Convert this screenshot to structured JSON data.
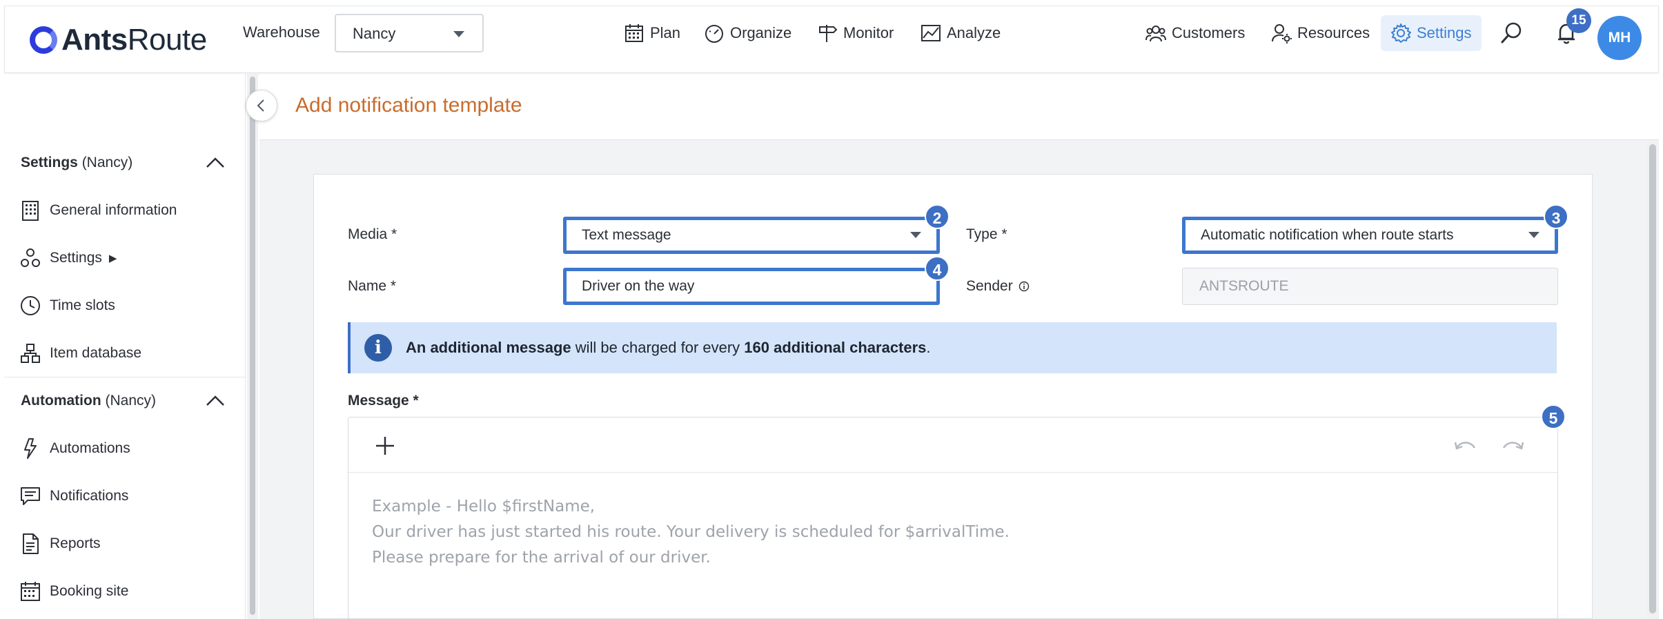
{
  "brand": {
    "name_bold": "Ants",
    "name_rest": "Route"
  },
  "warehouse": {
    "label": "Warehouse",
    "value": "Nancy"
  },
  "nav": {
    "plan": "Plan",
    "organize": "Organize",
    "monitor": "Monitor",
    "analyze": "Analyze",
    "customers": "Customers",
    "resources": "Resources",
    "settings": "Settings"
  },
  "notifications_count": "15",
  "user_initials": "MH",
  "sidebar": {
    "settings_section": {
      "title": "Settings",
      "scope": "(Nancy)"
    },
    "settings_items": [
      {
        "label": "General information",
        "icon": "building-icon"
      },
      {
        "label": "Settings",
        "icon": "cogs-icon",
        "arrow": "▶"
      },
      {
        "label": "Time slots",
        "icon": "clock-icon"
      },
      {
        "label": "Item database",
        "icon": "boxes-icon"
      }
    ],
    "automation_section": {
      "title": "Automation",
      "scope": "(Nancy)"
    },
    "automation_items": [
      {
        "label": "Automations",
        "icon": "bolt-icon"
      },
      {
        "label": "Notifications",
        "icon": "message-icon"
      },
      {
        "label": "Reports",
        "icon": "document-icon"
      },
      {
        "label": "Booking site",
        "icon": "calendar-icon"
      }
    ]
  },
  "page": {
    "title": "Add notification template"
  },
  "form": {
    "media": {
      "label": "Media *",
      "value": "Text message",
      "badge": "2"
    },
    "type": {
      "label": "Type *",
      "value": "Automatic notification when route starts",
      "badge": "3"
    },
    "name": {
      "label": "Name *",
      "value": "Driver on the way",
      "badge": "4"
    },
    "sender": {
      "label": "Sender",
      "value": "ANTSROUTE"
    }
  },
  "info": {
    "icon": "i",
    "part1_bold": "An additional message",
    "part2": " will be charged for every ",
    "part3_bold": "160 additional characters",
    "part4": "."
  },
  "message": {
    "label": "Message *",
    "badge": "5",
    "placeholder_lines": [
      "Example - Hello $firstName,",
      "Our driver has just started his route. Your delivery is scheduled for $arrivalTime.",
      "Please prepare for the arrival of our driver."
    ]
  },
  "colors": {
    "accent": "#3d6fc4",
    "title": "#c96c2c",
    "settings_active_bg": "#e8f1fb",
    "info_bg": "#d4e4fa"
  }
}
